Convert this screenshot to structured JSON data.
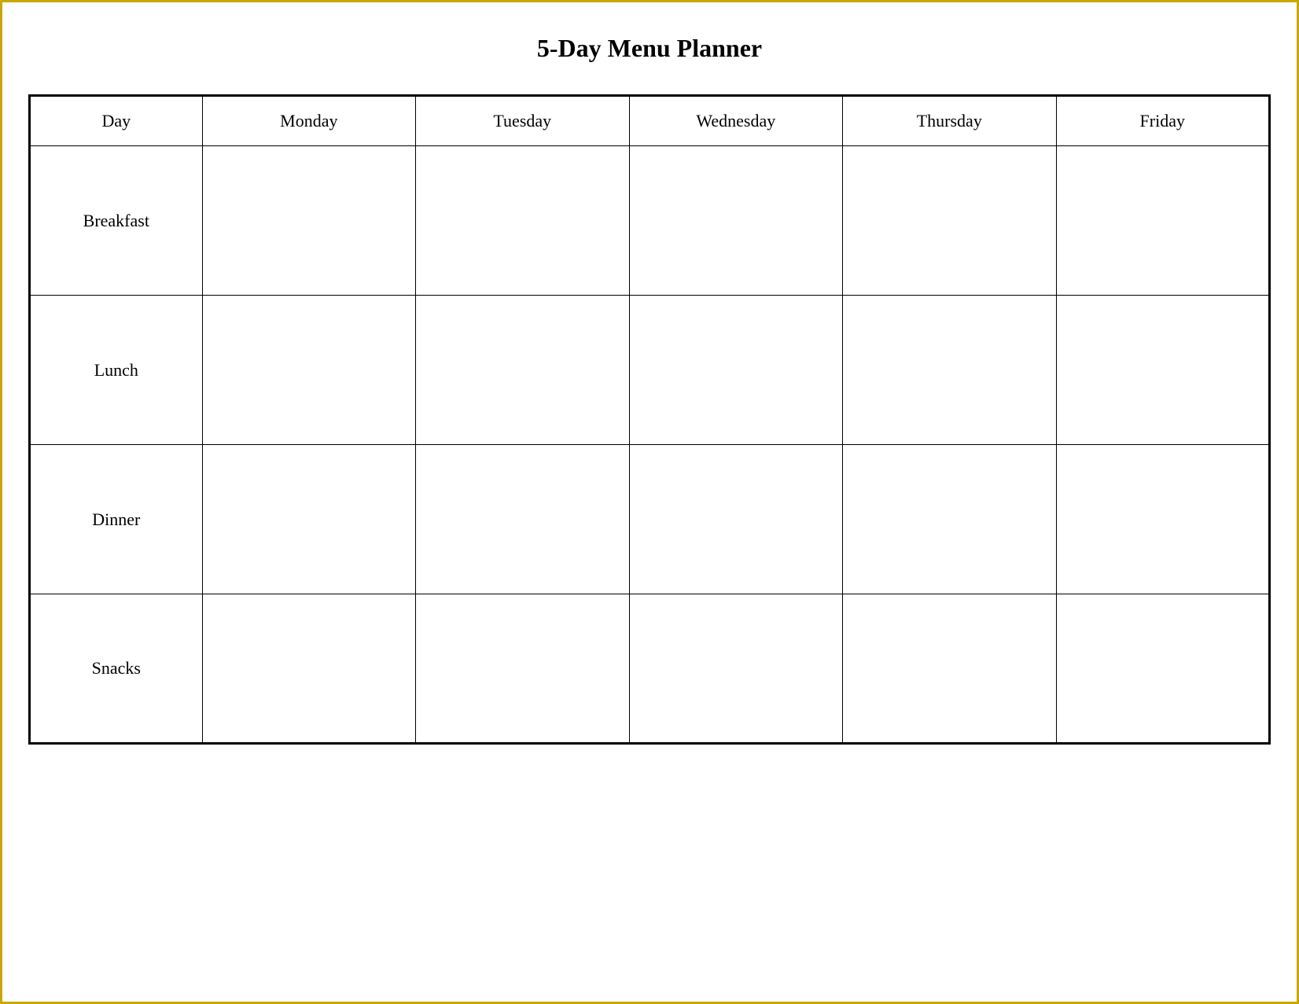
{
  "title": "5-Day Menu Planner",
  "columns": {
    "day_label": "Day",
    "monday": "Monday",
    "tuesday": "Tuesday",
    "wednesday": "Wednesday",
    "thursday": "Thursday",
    "friday": "Friday"
  },
  "meals": [
    {
      "label": "Breakfast"
    },
    {
      "label": "Lunch"
    },
    {
      "label": "Dinner"
    },
    {
      "label": "Snacks"
    }
  ]
}
